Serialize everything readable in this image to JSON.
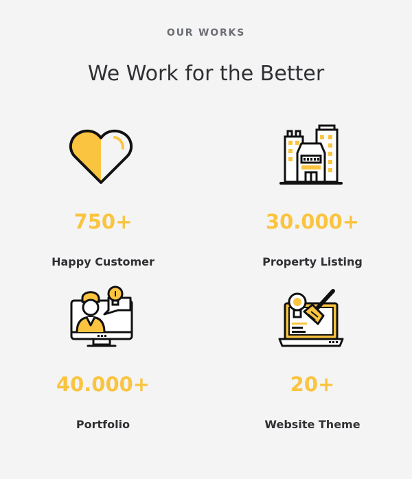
{
  "section": {
    "eyebrow": "OUR WORKS",
    "title": "We Work for the Better"
  },
  "stats": [
    {
      "icon": "heart-icon",
      "value": "750+",
      "label": "Happy Customer"
    },
    {
      "icon": "buildings-icon",
      "value": "30.000+",
      "label": "Property Listing"
    },
    {
      "icon": "presenter-monitor-icon",
      "value": "40.000+",
      "label": "Portfolio"
    },
    {
      "icon": "laptop-design-icon",
      "value": "20+",
      "label": "Website Theme"
    }
  ],
  "colors": {
    "accent": "#fac441",
    "stroke": "#111111",
    "background": "#f4f4f4"
  }
}
